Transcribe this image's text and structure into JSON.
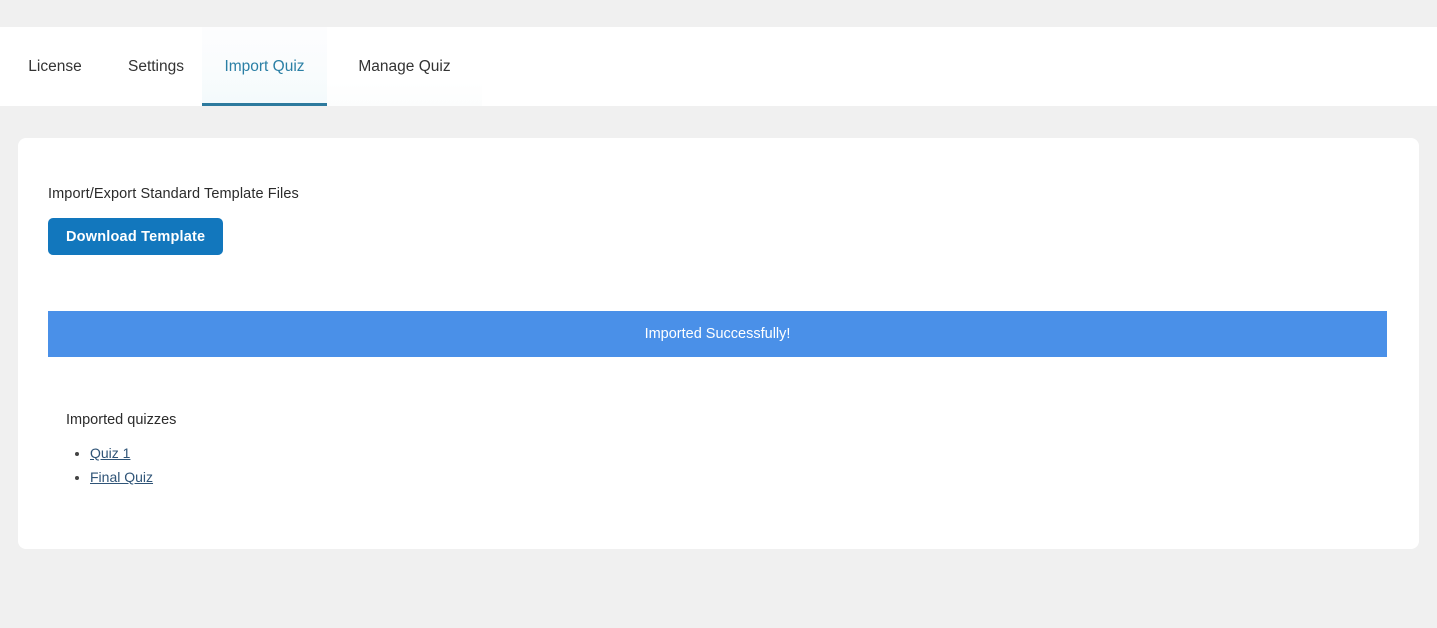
{
  "tabs": [
    {
      "label": "License",
      "active": false
    },
    {
      "label": "Settings",
      "active": false
    },
    {
      "label": "Import Quiz",
      "active": true
    },
    {
      "label": "Manage Quiz",
      "active": false
    }
  ],
  "main": {
    "section_label": "Import/Export Standard Template Files",
    "download_button": "Download Template",
    "notice_text": "Imported Successfully!",
    "list_title": "Imported quizzes",
    "quizzes": [
      {
        "label": "Quiz 1"
      },
      {
        "label": "Final Quiz"
      }
    ]
  },
  "colors": {
    "page_background": "#f0f0f0",
    "card_background": "#ffffff",
    "active_tab_text": "#2a7fa5",
    "active_tab_underline": "#2d7a9e",
    "inactive_tab_text": "#333333",
    "button_blue": "#1277bd",
    "notice_blue": "#4a90e8",
    "link_blue": "#2f5477"
  }
}
